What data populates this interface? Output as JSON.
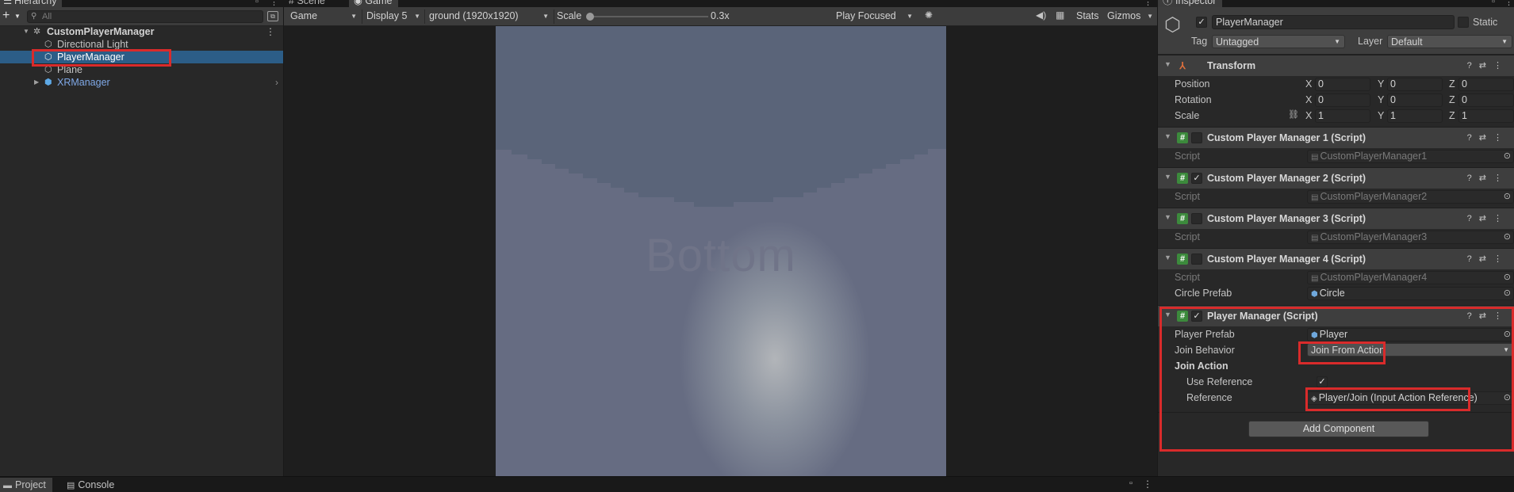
{
  "hierarchy": {
    "tab_label": "Hierarchy",
    "search_placeholder": "All",
    "items": [
      {
        "label": "CustomPlayerManager",
        "icon": "unity-scene-icon"
      },
      {
        "label": "Directional Light",
        "icon": "gameobject-icon"
      },
      {
        "label": "PlayerManager",
        "icon": "gameobject-icon",
        "selected": true
      },
      {
        "label": "Plane",
        "icon": "gameobject-icon"
      },
      {
        "label": "XRManager",
        "icon": "prefab-icon"
      }
    ]
  },
  "game": {
    "tabs": [
      {
        "label": "Scene",
        "icon": "hash-icon"
      },
      {
        "label": "Game",
        "icon": "gamepad-icon"
      }
    ],
    "mode": "Game",
    "display": "Display 5",
    "resolution": "ground (1920x1920)",
    "scale_label": "Scale",
    "scale_value": "0.3x",
    "scale_level": 0.0,
    "play_mode": "Play Focused",
    "stats_label": "Stats",
    "gizmos_label": "Gizmos",
    "viewport_text": "Bottom"
  },
  "inspector": {
    "tab_label": "Inspector",
    "object_name": "PlayerManager",
    "static_label": "Static",
    "tag_label": "Tag",
    "tag_value": "Untagged",
    "layer_label": "Layer",
    "layer_value": "Default",
    "transform": {
      "title": "Transform",
      "position_label": "Position",
      "rotation_label": "Rotation",
      "scale_label": "Scale",
      "position": {
        "x": "0",
        "y": "0",
        "z": "0"
      },
      "rotation": {
        "x": "0",
        "y": "0",
        "z": "0"
      },
      "scale": {
        "x": "1",
        "y": "1",
        "z": "1"
      }
    },
    "components": [
      {
        "title": "Custom Player Manager 1 (Script)",
        "enabled": false,
        "script_label": "Script",
        "script": "CustomPlayerManager1"
      },
      {
        "title": "Custom Player Manager 2 (Script)",
        "enabled": true,
        "script_label": "Script",
        "script": "CustomPlayerManager2"
      },
      {
        "title": "Custom Player Manager 3 (Script)",
        "enabled": false,
        "script_label": "Script",
        "script": "CustomPlayerManager3"
      },
      {
        "title": "Custom Player Manager 4 (Script)",
        "enabled": false,
        "script_label": "Script",
        "script": "CustomPlayerManager4",
        "extra_label": "Circle Prefab",
        "extra_value": "Circle"
      }
    ],
    "player_manager": {
      "title": "Player Manager (Script)",
      "enabled": true,
      "player_prefab_label": "Player Prefab",
      "player_prefab": "Player",
      "join_behavior_label": "Join Behavior",
      "join_behavior": "Join From Action",
      "join_action_label": "Join Action",
      "use_reference_label": "Use Reference",
      "use_reference": true,
      "reference_label": "Reference",
      "reference": "Player/Join (Input Action Reference)"
    },
    "add_component_label": "Add Component"
  },
  "bottom": {
    "tabs": [
      {
        "label": "Project",
        "icon": "folder-icon"
      },
      {
        "label": "Console",
        "icon": "console-icon"
      }
    ]
  },
  "colors": {
    "highlight_red": "#d92b2b",
    "selection_blue": "#2c5d87",
    "prefab_blue": "#7fa8e6"
  }
}
